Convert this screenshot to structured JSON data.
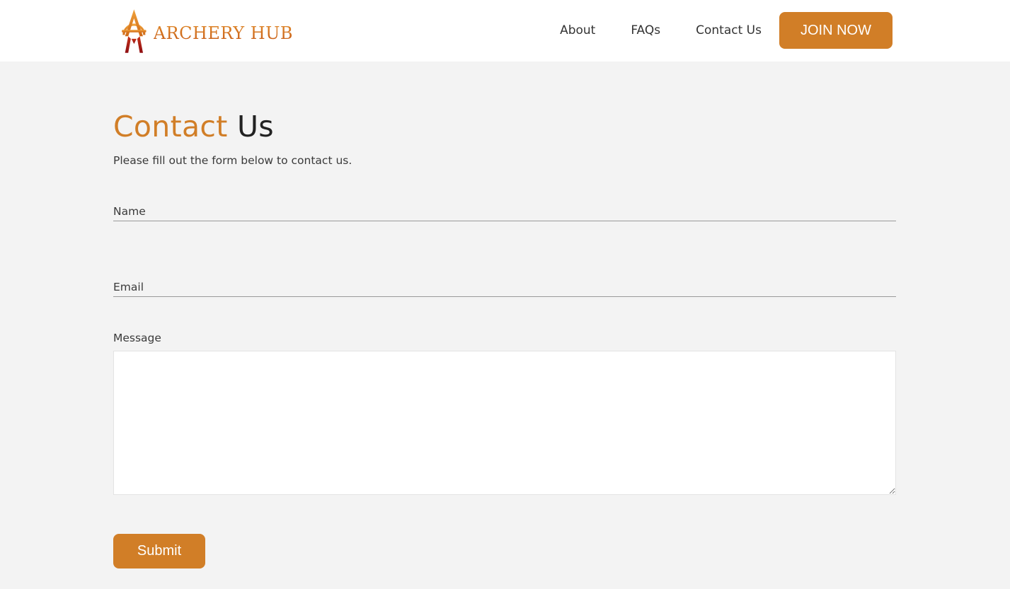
{
  "header": {
    "logo_text": "ARCHERY HUB",
    "nav": [
      {
        "label": "About"
      },
      {
        "label": "FAQs"
      },
      {
        "label": "Contact Us"
      }
    ],
    "join_label": "JOIN NOW"
  },
  "main": {
    "title_accent": "Contact",
    "title_rest": "Us",
    "intro": "Please fill out the form below to contact us.",
    "form": {
      "name_label": "Name",
      "name_value": "",
      "email_label": "Email",
      "email_value": "",
      "message_label": "Message",
      "message_value": "",
      "submit_label": "Submit"
    }
  },
  "colors": {
    "accent": "#d17e27",
    "header_bg": "#ffffff",
    "page_bg": "#f3f3f3",
    "logo_red": "#a3131a"
  },
  "icons": {
    "logo": "archery-bow-arrow-logo-icon"
  }
}
